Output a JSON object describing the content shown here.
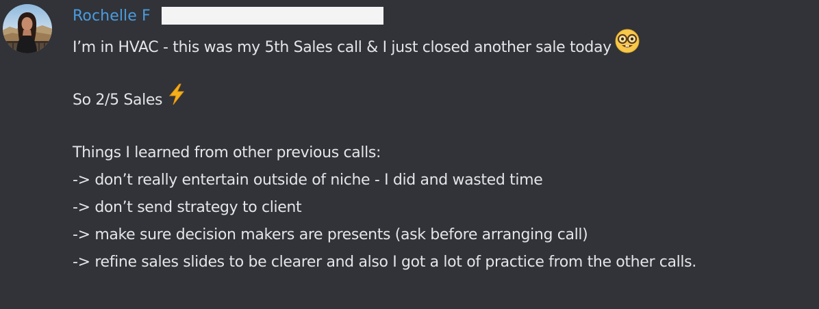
{
  "message": {
    "author": {
      "name": "Rochelle F",
      "name_color": "#4b9ce0"
    },
    "lines": [
      {
        "text": "I’m in HVAC - this was my 5th Sales call & I just closed another sale today",
        "emoji": "nerd-face"
      },
      {
        "text": "",
        "blank": true
      },
      {
        "text": "So 2/5 Sales",
        "emoji": "lightning-bolt"
      },
      {
        "text": "",
        "blank": true
      },
      {
        "text": "Things I learned from other previous calls:"
      },
      {
        "text": "-> don’t really entertain outside of niche - I did and wasted time"
      },
      {
        "text": "-> don’t send strategy to client"
      },
      {
        "text": "-> make sure decision makers are presents (ask before arranging call)"
      },
      {
        "text": "-> refine sales slides to be clearer and also I got a lot of practice from the other calls."
      }
    ]
  },
  "colors": {
    "background": "#313338",
    "text": "#e4e5e8",
    "redaction": "#f4f4f4"
  }
}
